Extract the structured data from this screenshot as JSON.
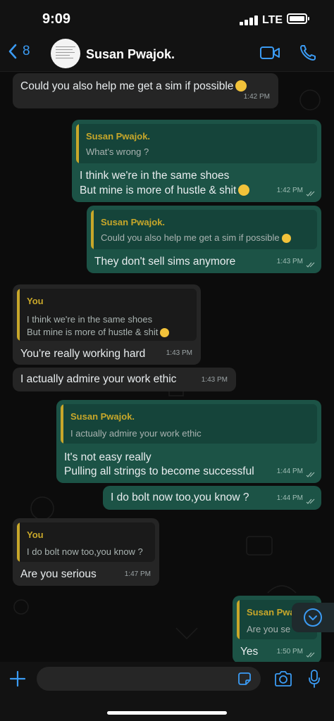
{
  "status_bar": {
    "time": "9:09",
    "network": "LTE"
  },
  "header": {
    "back_count": "8",
    "contact_name": "Susan Pwajok."
  },
  "messages": [
    {
      "text": "Could you also help me get a sim if possible",
      "time": "1:42 PM"
    },
    {
      "quote_name": "Susan Pwajok.",
      "quote_text": "What's wrong ?",
      "line1": "I think we're in the same shoes",
      "line2": "But mine is more of hustle & shit",
      "time": "1:42 PM"
    },
    {
      "quote_name": "Susan Pwajok.",
      "quote_text": "Could you also help me get a sim if possible",
      "text": "They don't sell sims anymore",
      "time": "1:43 PM"
    },
    {
      "quote_name": "You",
      "quote_line1": "I think we're in the same shoes",
      "quote_line2": "But mine is more of hustle & shit",
      "text": "You're really working hard",
      "time": "1:43 PM"
    },
    {
      "text": "I actually admire your work ethic",
      "time": "1:43 PM"
    },
    {
      "quote_name": "Susan Pwajok.",
      "quote_text": "I actually admire your work ethic",
      "line1": "It's not easy really",
      "line2": "Pulling all strings to become successful",
      "time": "1:44 PM"
    },
    {
      "text": "I do bolt now too,you know ?",
      "time": "1:44 PM"
    },
    {
      "quote_name": "You",
      "quote_text": "I do bolt now too,you know ?",
      "text": "Are you serious",
      "time": "1:47 PM"
    },
    {
      "quote_name": "Susan Pwa",
      "quote_text": "Are you se",
      "text": "Yes",
      "time": "1:50 PM"
    }
  ],
  "icons": {
    "back": "chevron-left-icon",
    "video": "video-camera-icon",
    "call": "phone-icon",
    "scroll": "chevron-down-icon",
    "attach": "plus-icon",
    "sticker": "sticker-icon",
    "camera": "camera-icon",
    "mic": "microphone-icon"
  },
  "colors": {
    "accent": "#3b9bf3",
    "outgoing_bubble": "#1c5346",
    "incoming_bubble": "#252525",
    "quote_name": "#c8a72a"
  }
}
